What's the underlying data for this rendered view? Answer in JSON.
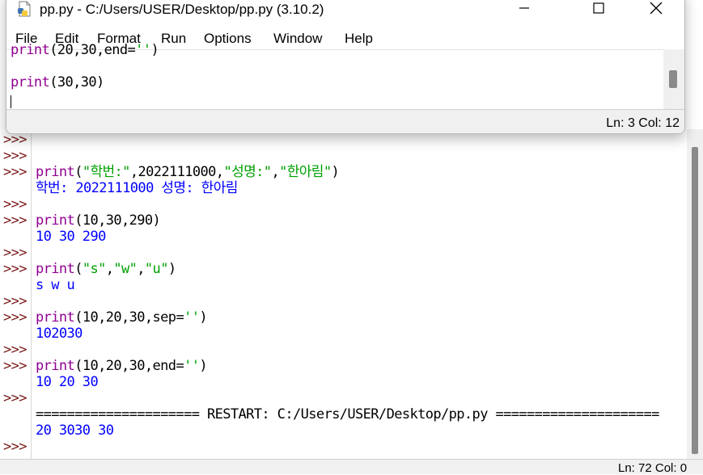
{
  "editor": {
    "title": "pp.py - C:/Users/USER/Desktop/pp.py (3.10.2)",
    "menu": [
      "File",
      "Edit",
      "Format",
      "Run",
      "Options",
      "Window",
      "Help"
    ],
    "lines": [
      {
        "kw": "print",
        "rest": "(20,30,end=",
        "str": "''",
        "close": ")"
      },
      {
        "kw": "print",
        "rest": "(30,30)"
      }
    ],
    "status": "Ln: 3   Col: 12"
  },
  "shell": {
    "prompt": ">>>",
    "lines": [
      {
        "prompt": ">>>",
        "kind": "empty"
      },
      {
        "prompt": ">>>",
        "kind": "empty"
      },
      {
        "prompt": ">>>",
        "kind": "code",
        "parts": [
          [
            "kw",
            "print"
          ],
          [
            "plain",
            "("
          ],
          [
            "st",
            "\"학번:\""
          ],
          [
            "plain",
            ",2022111000,"
          ],
          [
            "st",
            "\"성명:\""
          ],
          [
            "plain",
            ","
          ],
          [
            "st",
            "\"한아림\""
          ],
          [
            "plain",
            ")"
          ]
        ]
      },
      {
        "prompt": "",
        "kind": "out",
        "text": "학번: 2022111000 성명: 한아림"
      },
      {
        "prompt": ">>>",
        "kind": "empty"
      },
      {
        "prompt": ">>>",
        "kind": "code",
        "parts": [
          [
            "kw",
            "print"
          ],
          [
            "plain",
            "(10,30,290)"
          ]
        ]
      },
      {
        "prompt": "",
        "kind": "out",
        "text": "10 30 290"
      },
      {
        "prompt": ">>>",
        "kind": "empty"
      },
      {
        "prompt": ">>>",
        "kind": "code",
        "parts": [
          [
            "kw",
            "print"
          ],
          [
            "plain",
            "("
          ],
          [
            "st",
            "\"s\""
          ],
          [
            "plain",
            ","
          ],
          [
            "st",
            "\"w\""
          ],
          [
            "plain",
            ","
          ],
          [
            "st",
            "\"u\""
          ],
          [
            "plain",
            ")"
          ]
        ]
      },
      {
        "prompt": "",
        "kind": "out",
        "text": "s w u"
      },
      {
        "prompt": ">>>",
        "kind": "empty"
      },
      {
        "prompt": ">>>",
        "kind": "code",
        "parts": [
          [
            "kw",
            "print"
          ],
          [
            "plain",
            "(10,20,30,sep="
          ],
          [
            "st",
            "''"
          ],
          [
            "plain",
            ")"
          ]
        ]
      },
      {
        "prompt": "",
        "kind": "out",
        "text": "102030"
      },
      {
        "prompt": ">>>",
        "kind": "empty"
      },
      {
        "prompt": ">>>",
        "kind": "code",
        "parts": [
          [
            "kw",
            "print"
          ],
          [
            "plain",
            "(10,20,30,end="
          ],
          [
            "st",
            "''"
          ],
          [
            "plain",
            ")"
          ]
        ]
      },
      {
        "prompt": "",
        "kind": "out",
        "text": "10 20 30"
      },
      {
        "prompt": ">>>",
        "kind": "empty"
      },
      {
        "prompt": "",
        "kind": "restart",
        "text": "===================== RESTART: C:/Users/USER/Desktop/pp.py ====================="
      },
      {
        "prompt": "",
        "kind": "out",
        "text": "20 3030 30"
      },
      {
        "prompt": ">>>",
        "kind": "empty"
      }
    ],
    "status": "Ln: 72   Col: 0"
  },
  "icons": {
    "app": "python-file-icon",
    "minimize": "minimize-icon",
    "maximize": "maximize-icon",
    "close": "close-icon"
  },
  "colors": {
    "keyword": "#900090",
    "string": "#00a000",
    "output": "#0000ff",
    "prompt": "#7a1a1a"
  }
}
